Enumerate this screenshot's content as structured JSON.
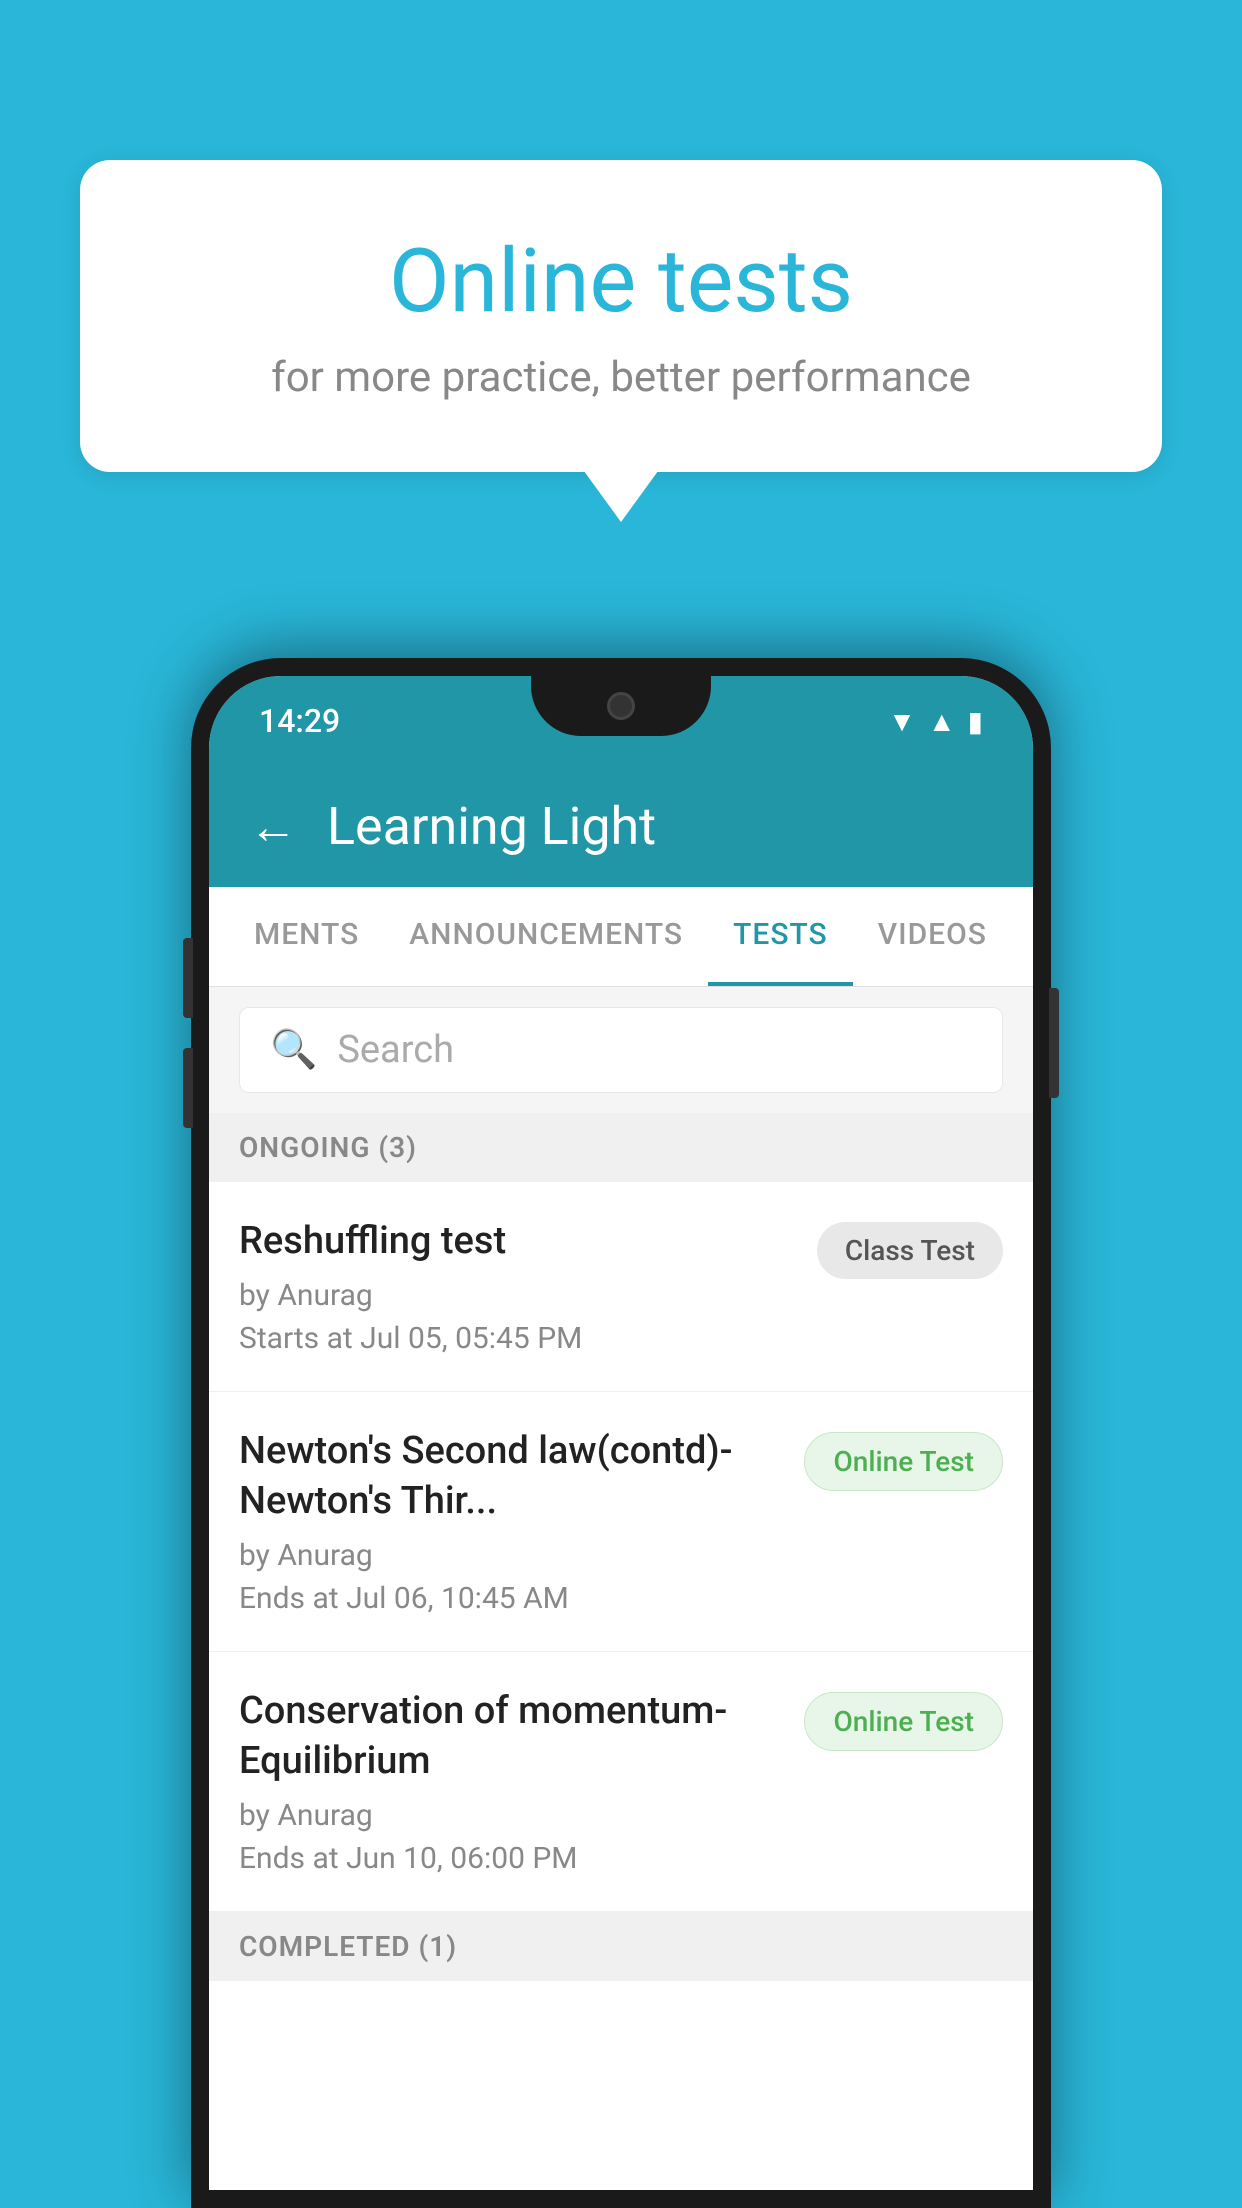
{
  "background_color": "#29b6d8",
  "speech_bubble": {
    "title": "Online tests",
    "subtitle": "for more practice, better performance"
  },
  "phone": {
    "status_bar": {
      "time": "14:29",
      "icons": [
        "wifi",
        "signal",
        "battery"
      ]
    },
    "app_header": {
      "title": "Learning Light",
      "back_label": "←"
    },
    "tabs": [
      {
        "label": "MENTS",
        "active": false
      },
      {
        "label": "ANNOUNCEMENTS",
        "active": false
      },
      {
        "label": "TESTS",
        "active": true
      },
      {
        "label": "VIDEOS",
        "active": false
      }
    ],
    "search": {
      "placeholder": "Search"
    },
    "ongoing_section": {
      "label": "ONGOING (3)"
    },
    "test_items": [
      {
        "name": "Reshuffling test",
        "author": "by Anurag",
        "time_label": "Starts at",
        "time": "Jul 05, 05:45 PM",
        "badge": "Class Test",
        "badge_type": "class"
      },
      {
        "name": "Newton's Second law(contd)-Newton's Thir...",
        "author": "by Anurag",
        "time_label": "Ends at",
        "time": "Jul 06, 10:45 AM",
        "badge": "Online Test",
        "badge_type": "online"
      },
      {
        "name": "Conservation of momentum-Equilibrium",
        "author": "by Anurag",
        "time_label": "Ends at",
        "time": "Jun 10, 06:00 PM",
        "badge": "Online Test",
        "badge_type": "online"
      }
    ],
    "completed_section": {
      "label": "COMPLETED (1)"
    }
  }
}
